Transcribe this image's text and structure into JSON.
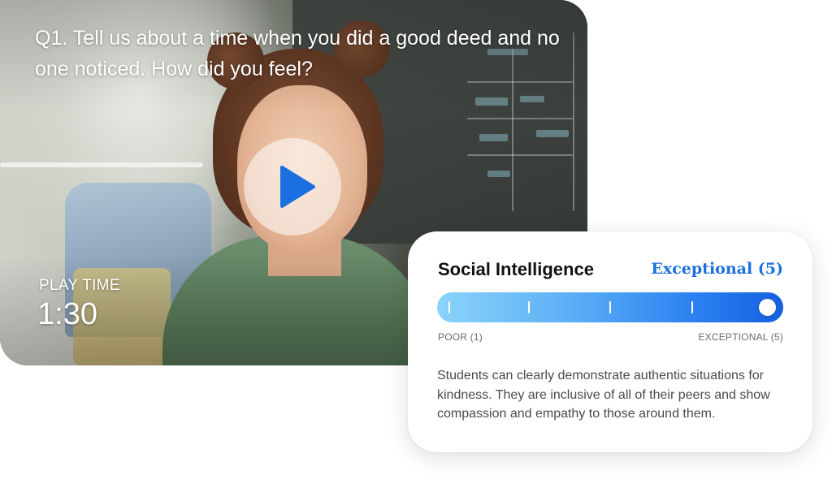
{
  "video": {
    "question": "Q1. Tell us about a time when you did a good deed and no one noticed. How did you feel?",
    "play_time_label": "PLAY TIME",
    "play_time_value": "1:30",
    "play_icon": "play-icon",
    "accent_color": "#1c6fe0"
  },
  "rating": {
    "skill": "Social Intelligence",
    "result": "Exceptional (5)",
    "scale_min_label": "POOR (1)",
    "scale_max_label": "EXCEPTIONAL (5)",
    "scale_min": 1,
    "scale_max": 5,
    "value": 5,
    "description": "Students can clearly demonstrate authentic situations for kindness. They are inclusive of all of their peers and show compassion and empathy to those around them.",
    "result_color": "#1c6fe0",
    "bar_colors": [
      "#8bd3fb",
      "#1560e0"
    ]
  }
}
